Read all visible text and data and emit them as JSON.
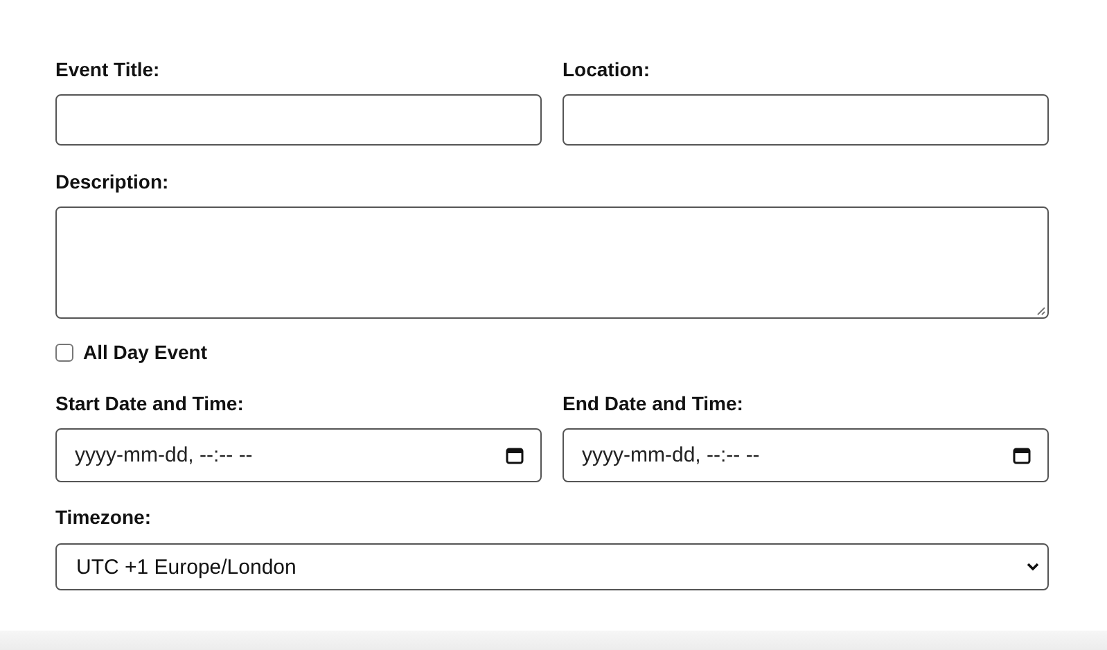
{
  "event_title": {
    "label": "Event Title:"
  },
  "location": {
    "label": "Location:"
  },
  "description": {
    "label": "Description:"
  },
  "all_day": {
    "label": "All Day Event",
    "checked": false
  },
  "start": {
    "label": "Start Date and Time:",
    "placeholder": "yyyy-mm-dd, --:-- --"
  },
  "end": {
    "label": "End Date and Time:",
    "placeholder": "yyyy-mm-dd, --:-- --"
  },
  "timezone": {
    "label": "Timezone:",
    "value": "UTC +1 Europe/London"
  }
}
